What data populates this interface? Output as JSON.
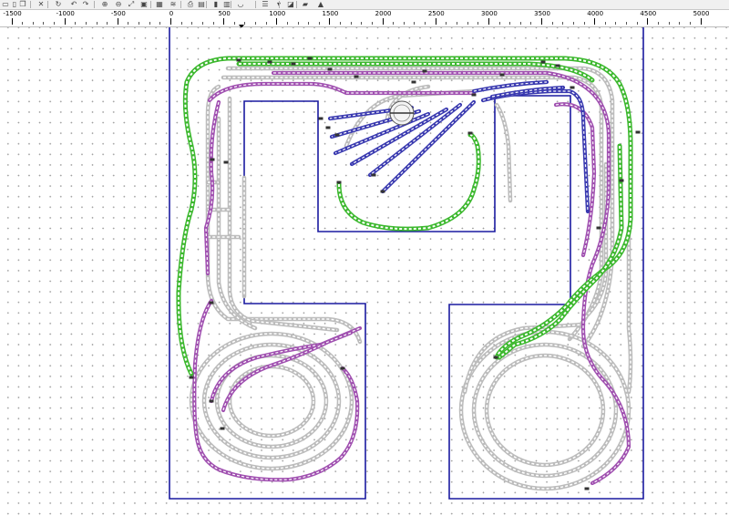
{
  "toolbar": {
    "buttons": [
      {
        "name": "new-file-icon",
        "glyph": "▭"
      },
      {
        "name": "open-file-icon",
        "glyph": "▯"
      },
      {
        "name": "copy-icon",
        "glyph": "❐"
      },
      {
        "name": "delete-icon",
        "glyph": "✕"
      },
      {
        "name": "rotate-icon",
        "glyph": "↻"
      },
      {
        "name": "undo-icon",
        "glyph": "↶"
      },
      {
        "name": "redo-icon",
        "glyph": "↷"
      },
      {
        "name": "zoom-in-icon",
        "glyph": "⊕"
      },
      {
        "name": "zoom-out-icon",
        "glyph": "⊖"
      },
      {
        "name": "zoom-fit-icon",
        "glyph": "⤢"
      },
      {
        "name": "zoom-window-icon",
        "glyph": "▣"
      },
      {
        "name": "image-icon",
        "glyph": "▦"
      },
      {
        "name": "layers-icon",
        "glyph": "≋"
      },
      {
        "name": "print-icon",
        "glyph": "⎙"
      },
      {
        "name": "preview-icon",
        "glyph": "▤"
      },
      {
        "name": "fire-extinguisher-icon",
        "glyph": "▮"
      },
      {
        "name": "save-icon",
        "glyph": "▥"
      },
      {
        "name": "dashboard-icon",
        "glyph": "◡"
      },
      {
        "name": "list-view-icon",
        "glyph": "☰"
      },
      {
        "name": "dropdown-arrow-icon",
        "glyph": "▾"
      },
      {
        "name": "box-3d-icon",
        "glyph": "◪"
      },
      {
        "name": "train-icon",
        "glyph": "▰"
      },
      {
        "name": "landscape-icon",
        "glyph": "▲"
      }
    ]
  },
  "ruler": {
    "labels": [
      "-1500",
      "-1000",
      "-500",
      "0",
      "500",
      "1000",
      "1500",
      "2000",
      "2500",
      "3000",
      "3500",
      "4000",
      "4500",
      "5000"
    ]
  },
  "colors": {
    "background": "#ffffff",
    "grid_dot": "#9a9a9a",
    "baseboard_outline": "#1a1aa0",
    "track_green": "#3cb82e",
    "track_purple": "#a050b0",
    "track_blue": "#3a3ab0",
    "track_grey": "#bcbcbc"
  }
}
